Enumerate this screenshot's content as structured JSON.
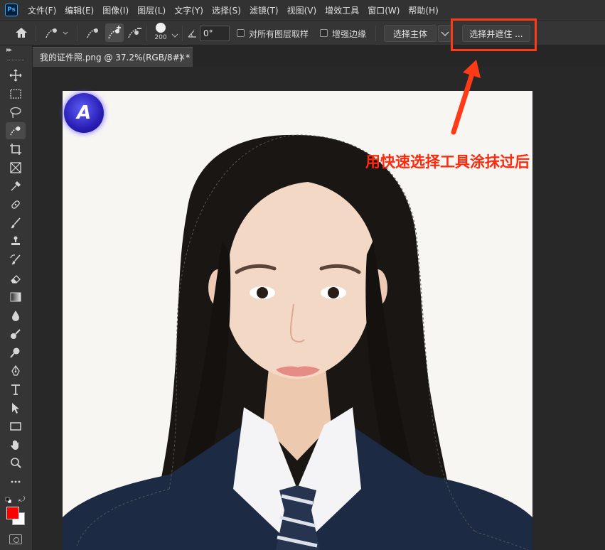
{
  "app": {
    "logo_text": "Ps"
  },
  "menu": [
    "文件(F)",
    "编辑(E)",
    "图像(I)",
    "图层(L)",
    "文字(Y)",
    "选择(S)",
    "滤镜(T)",
    "视图(V)",
    "增效工具",
    "窗口(W)",
    "帮助(H)"
  ],
  "options": {
    "brush_size": "200",
    "angle_value": "0°",
    "sample_all_layers_label": "对所有图层取样",
    "enhance_edge_label": "增强边缘",
    "select_subject_label": "选择主体",
    "select_and_mask_label": "选择并遮住 ..."
  },
  "document": {
    "tab_title": "我的证件照.png @ 37.2%(RGB/8#) *",
    "close_glyph": "×"
  },
  "photo": {
    "logo_letter": "A"
  },
  "annotation": {
    "text": "用快速选择工具涂抹过后",
    "color": "#ff2a0d"
  },
  "colors": {
    "foreground": "#ff0000",
    "background": "#ffffff",
    "accent": "#31a8ff"
  },
  "tools": [
    "move-icon",
    "marquee-icon",
    "lasso-icon",
    "quick-selection-icon",
    "crop-icon",
    "frame-icon",
    "eyedropper-icon",
    "healing-icon",
    "brush-icon",
    "stamp-icon",
    "history-brush-icon",
    "eraser-icon",
    "gradient-icon",
    "blur-icon",
    "dodge-icon",
    "smudge-icon",
    "pen-icon",
    "type-icon",
    "path-selection-icon",
    "rectangle-icon",
    "hand-icon",
    "zoom-icon",
    "more-tools-icon"
  ]
}
